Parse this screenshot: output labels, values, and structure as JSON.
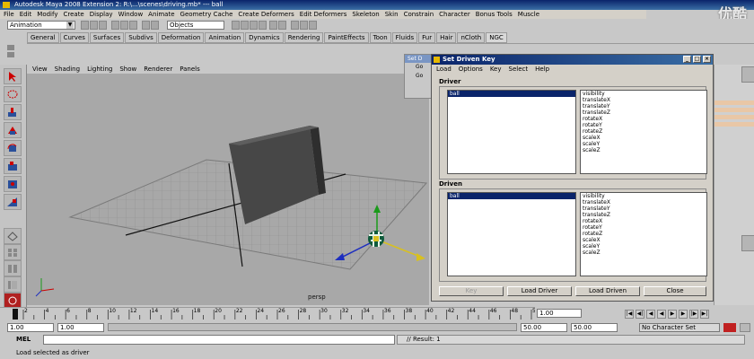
{
  "window": {
    "title": "Autodesk Maya 2008 Extension 2: R:\\...\\scenes\\driving.mb* --- ball"
  },
  "watermark": "优酷",
  "menu_bar": [
    "File",
    "Edit",
    "Modify",
    "Create",
    "Display",
    "Window",
    "Animate",
    "Geometry Cache",
    "Create Deformers",
    "Edit Deformers",
    "Skeleton",
    "Skin",
    "Constrain",
    "Character",
    "Bonus Tools",
    "Muscle"
  ],
  "status_line": {
    "mode": "Animation",
    "selection_field": "Objects"
  },
  "shelf_tabs": [
    "General",
    "Curves",
    "Surfaces",
    "Subdivs",
    "Deformation",
    "Animation",
    "Dynamics",
    "Rendering",
    "PaintEffects",
    "Toon",
    "Fluids",
    "Fur",
    "Hair",
    "nCloth",
    "NGC"
  ],
  "shelf_active_tab": "NGC",
  "viewport": {
    "menu": [
      "View",
      "Shading",
      "Lighting",
      "Show",
      "Renderer",
      "Panels"
    ],
    "camera_label": "persp"
  },
  "background_dialog": {
    "title": "Set D",
    "items": [
      "Go",
      "Go"
    ]
  },
  "set_driven_key": {
    "title": "Set Driven Key",
    "menu": [
      "Load",
      "Options",
      "Key",
      "Select",
      "Help"
    ],
    "driver": {
      "label": "Driver",
      "objects": [
        "ball"
      ],
      "attributes": [
        "visibility",
        "translateX",
        "translateY",
        "translateZ",
        "rotateX",
        "rotateY",
        "rotateZ",
        "scaleX",
        "scaleY",
        "scaleZ"
      ]
    },
    "driven": {
      "label": "Driven",
      "objects": [
        "ball"
      ],
      "attributes": [
        "visibility",
        "translateX",
        "translateY",
        "translateZ",
        "rotateX",
        "rotateY",
        "rotateZ",
        "scaleX",
        "scaleY",
        "scaleZ"
      ]
    },
    "buttons": {
      "key": "Key",
      "load_driver": "Load Driver",
      "load_driven": "Load Driven",
      "close": "Close"
    }
  },
  "time_slider": {
    "ticks": [
      "2",
      "4",
      "6",
      "8",
      "10",
      "12",
      "14",
      "16",
      "18",
      "20",
      "22",
      "24",
      "26",
      "28",
      "30",
      "32",
      "34",
      "36",
      "38",
      "40",
      "42",
      "44",
      "46",
      "48",
      "50"
    ],
    "current_time": "1.00"
  },
  "range_slider": {
    "start_time": "1.00",
    "start_range": "1.00",
    "end_range": "50.00",
    "end_time": "50.00",
    "character_set": "No Character Set"
  },
  "command_line": {
    "label": "MEL",
    "result": "// Result: 1"
  },
  "help_line": "Load selected as driver"
}
